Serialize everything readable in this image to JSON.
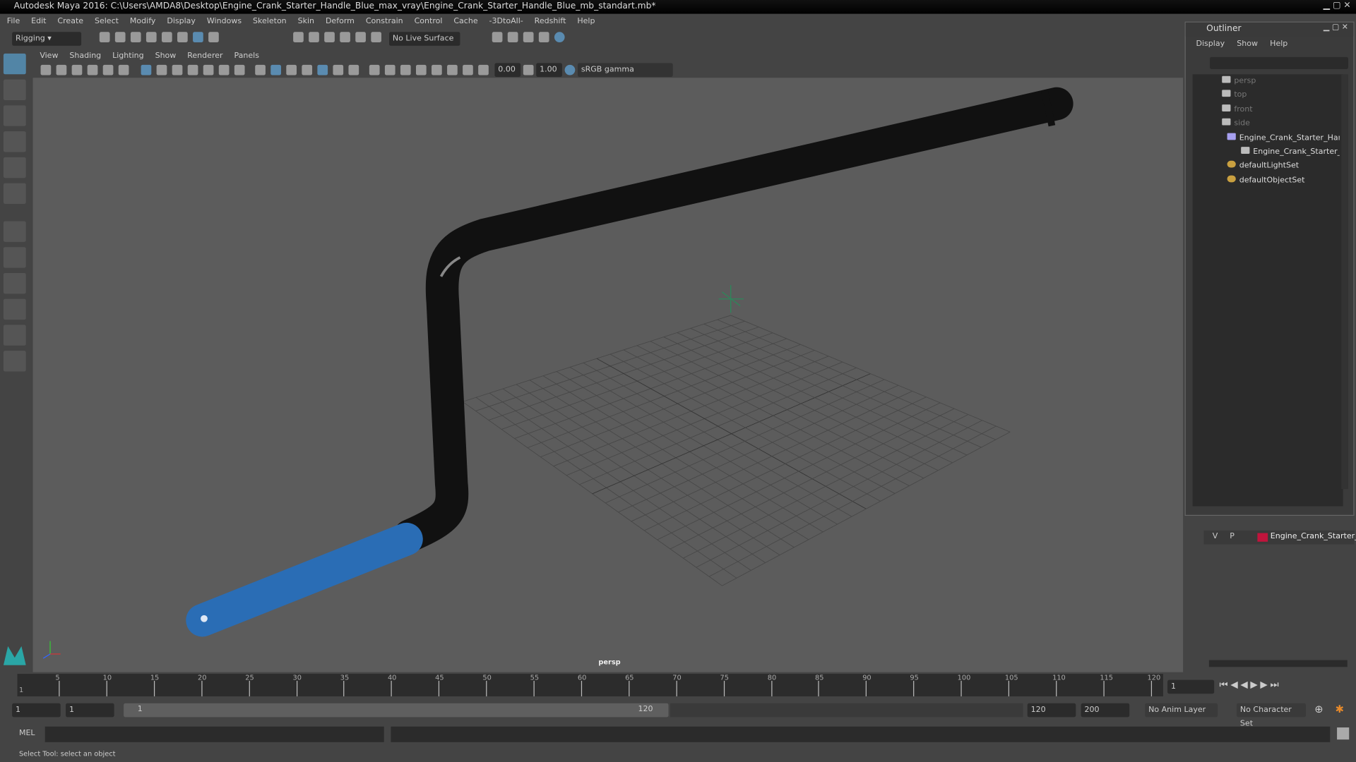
{
  "title": "Autodesk Maya 2016: C:\\Users\\AMDA8\\Desktop\\Engine_Crank_Starter_Handle_Blue_max_vray\\Engine_Crank_Starter_Handle_Blue_mb_standart.mb*",
  "menu": [
    "File",
    "Edit",
    "Create",
    "Select",
    "Modify",
    "Display",
    "Windows",
    "Skeleton",
    "Skin",
    "Deform",
    "Constrain",
    "Control",
    "Cache",
    "-3DtoAll-",
    "Redshift",
    "Help"
  ],
  "shelf": {
    "mode": "Rigging",
    "live_surface": "No Live Surface"
  },
  "panel_menu": [
    "View",
    "Shading",
    "Lighting",
    "Show",
    "Renderer",
    "Panels"
  ],
  "panel_toolbar": {
    "exposure": "0.00",
    "gamma": "1.00",
    "colorspace": "sRGB gamma"
  },
  "viewport": {
    "camera_label": "persp",
    "object_color": "#2a6db5"
  },
  "outliner": {
    "title": "Outliner",
    "menu": [
      "Display",
      "Show",
      "Help"
    ],
    "items": [
      {
        "label": "persp",
        "icon": "camera-icon",
        "dim": true
      },
      {
        "label": "top",
        "icon": "camera-icon",
        "dim": true
      },
      {
        "label": "front",
        "icon": "camera-icon",
        "dim": true
      },
      {
        "label": "side",
        "icon": "camera-icon",
        "dim": true
      },
      {
        "label": "Engine_Crank_Starter_Handl",
        "icon": "group-icon"
      },
      {
        "label": "Engine_Crank_Starter_Ha",
        "icon": "mesh-icon"
      },
      {
        "label": "defaultLightSet",
        "icon": "set-icon"
      },
      {
        "label": "defaultObjectSet",
        "icon": "set-icon"
      }
    ]
  },
  "layers": {
    "v": "V",
    "p": "P",
    "name": "Engine_Crank_Starter_",
    "color": "#c0143c"
  },
  "timeline": {
    "ticks": [
      "5",
      "10",
      "15",
      "20",
      "25",
      "30",
      "35",
      "40",
      "45",
      "50",
      "55",
      "60",
      "65",
      "70",
      "75",
      "80",
      "85",
      "90",
      "95",
      "100",
      "105",
      "110",
      "115",
      "120"
    ],
    "start_label": "1",
    "current_frame": "1"
  },
  "range": {
    "start": "1",
    "anim_start": "1",
    "slider_start": "1",
    "slider_end": "120",
    "end": "120",
    "anim_end": "200",
    "anim_layer": "No Anim Layer",
    "char_set": "No Character Set"
  },
  "cmd": {
    "label": "MEL"
  },
  "help_line": "Select Tool: select an object"
}
